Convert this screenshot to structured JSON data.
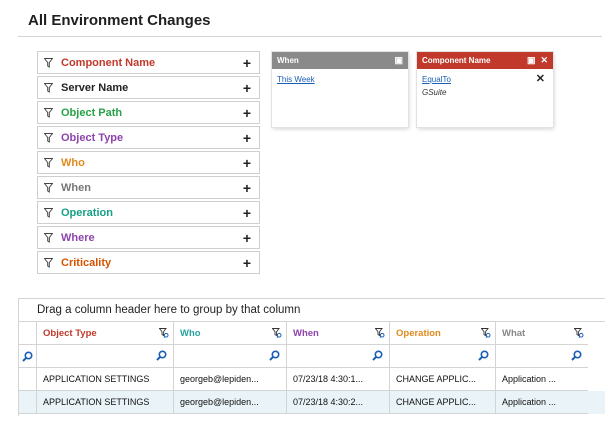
{
  "page": {
    "title": "All Environment Changes"
  },
  "filters": [
    {
      "label": "Component Name",
      "color": "#c0392b",
      "icon": "plus-icon"
    },
    {
      "label": "Server Name",
      "color": "#222222",
      "icon": "plus-icon"
    },
    {
      "label": "Object Path",
      "color": "#27a347",
      "icon": "plus-icon"
    },
    {
      "label": "Object Type",
      "color": "#8e44ad",
      "icon": "plus-icon"
    },
    {
      "label": "Who",
      "color": "#e08a1e",
      "icon": "plus-icon"
    },
    {
      "label": "When",
      "color": "#777777",
      "icon": "plus-icon"
    },
    {
      "label": "Operation",
      "color": "#16a085",
      "icon": "plus-icon"
    },
    {
      "label": "Where",
      "color": "#8e44ad",
      "icon": "plus-icon"
    },
    {
      "label": "Criticality",
      "color": "#d35400",
      "icon": "plus-icon"
    }
  ],
  "cards": {
    "when": {
      "title": "When",
      "header_color": "#8a8a8a",
      "link": "This Week"
    },
    "component": {
      "title": "Component Name",
      "header_color": "#c0392b",
      "link": "EqualTo",
      "value": "GSuite"
    }
  },
  "grid": {
    "group_hint": "Drag a column header here to group by that column",
    "columns": [
      {
        "label": "Object Type",
        "color": "#c0392b"
      },
      {
        "label": "Who",
        "color": "#27a3a0"
      },
      {
        "label": "When",
        "color": "#8e44ad"
      },
      {
        "label": "Operation",
        "color": "#e08a1e"
      },
      {
        "label": "What",
        "color": "#888888"
      }
    ],
    "rows": [
      [
        "APPLICATION SETTINGS",
        "georgeb@lepiden...",
        "07/23/18 4:30:1...",
        "CHANGE APPLIC...",
        "Application ..."
      ],
      [
        "APPLICATION SETTINGS",
        "georgeb@lepiden...",
        "07/23/18 4:30:2...",
        "CHANGE APPLIC...",
        "Application ..."
      ]
    ]
  }
}
